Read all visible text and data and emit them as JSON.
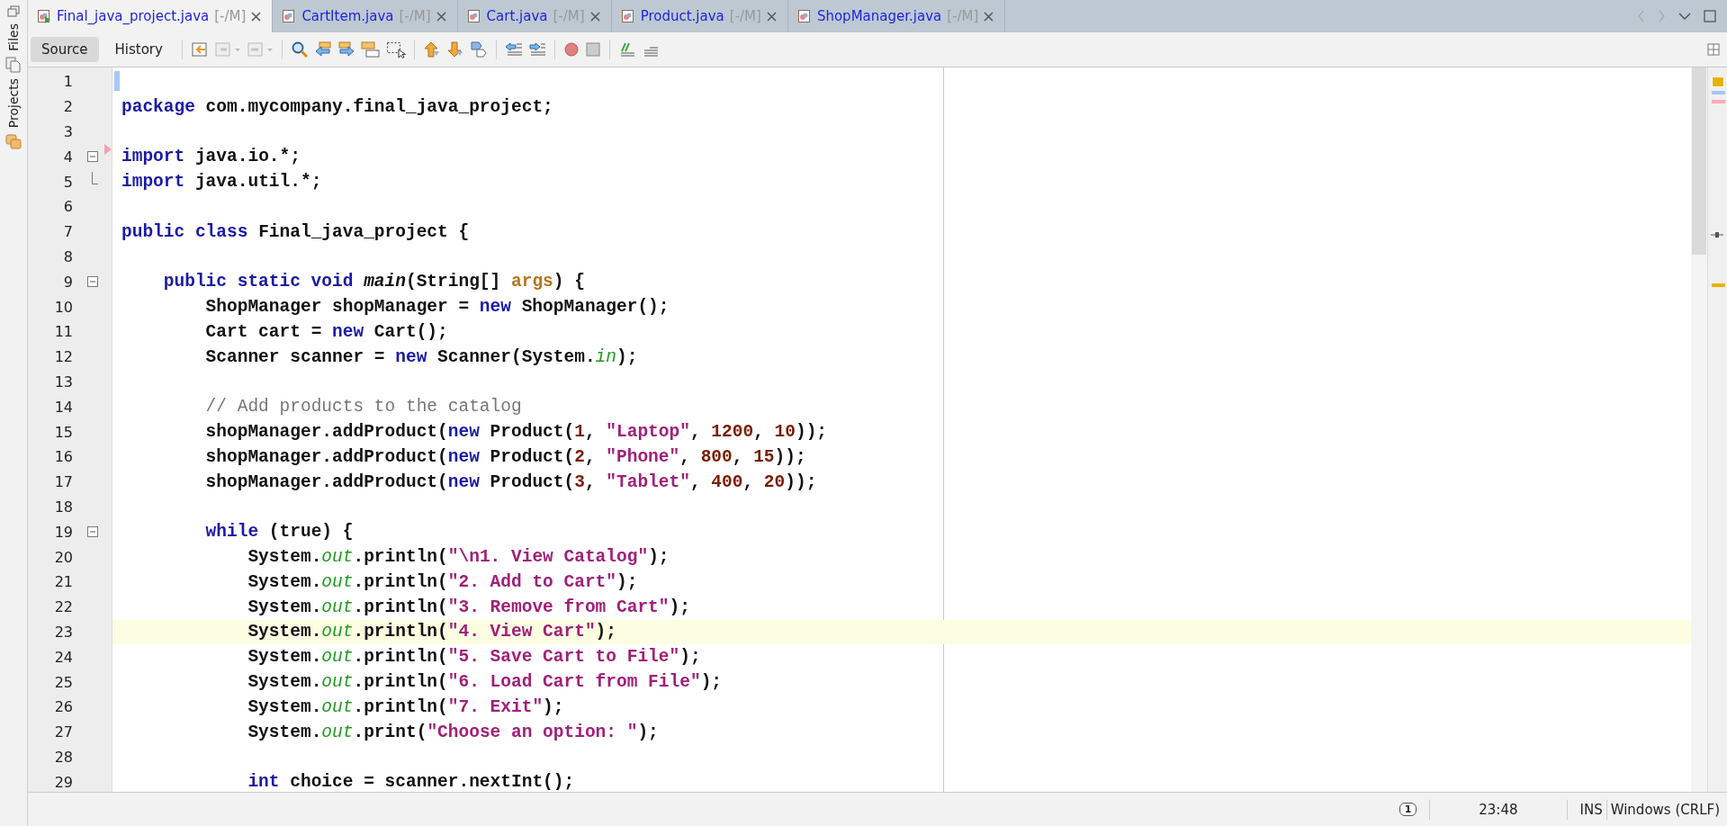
{
  "side_panel": {
    "tabs": [
      {
        "label": "Files"
      },
      {
        "label": "Projects"
      }
    ]
  },
  "tabs": [
    {
      "label": "Final_java_project.java",
      "status": "[-/M]",
      "selected": true,
      "runnable": true
    },
    {
      "label": "CartItem.java",
      "status": "[-/M]",
      "selected": false,
      "runnable": false
    },
    {
      "label": "Cart.java",
      "status": "[-/M]",
      "selected": false,
      "runnable": false
    },
    {
      "label": "Product.java",
      "status": "[-/M]",
      "selected": false,
      "runnable": false
    },
    {
      "label": "ShopManager.java",
      "status": "[-/M]",
      "selected": false,
      "runnable": false
    }
  ],
  "view_buttons": [
    {
      "label": "Source",
      "selected": true
    },
    {
      "label": "History",
      "selected": false
    }
  ],
  "editor": {
    "lines": [
      {
        "number": "1",
        "current": false,
        "caret": true
      },
      {
        "number": "2",
        "tokens": [
          {
            "kind": "kw",
            "text": "package"
          },
          {
            "kind": "plain",
            "text": " com.mycompany.final_java_project;"
          }
        ],
        "current": false
      },
      {
        "number": "3",
        "current": false
      },
      {
        "number": "4",
        "tokens": [
          {
            "kind": "kw",
            "text": "import"
          },
          {
            "kind": "plain",
            "text": " java.io.*;"
          }
        ],
        "current": false,
        "fold_start": true,
        "marker": true
      },
      {
        "number": "5",
        "tokens": [
          {
            "kind": "kw",
            "text": "import"
          },
          {
            "kind": "plain",
            "text": " java.util.*;"
          }
        ],
        "current": false,
        "fold_end": true
      },
      {
        "number": "6",
        "current": false
      },
      {
        "number": "7",
        "tokens": [
          {
            "kind": "kw",
            "text": "public class"
          },
          {
            "kind": "plain",
            "text": " Final_java_project {"
          }
        ],
        "current": false
      },
      {
        "number": "8",
        "current": false
      },
      {
        "number": "9",
        "tokens": [
          {
            "kind": "kw",
            "text": "    public static void "
          },
          {
            "kind": "method",
            "text": "main"
          },
          {
            "kind": "plain",
            "text": "(String[] "
          },
          {
            "kind": "param",
            "text": "args"
          },
          {
            "kind": "plain",
            "text": ") {"
          }
        ],
        "current": false,
        "fold_start": true
      },
      {
        "number": "10",
        "tokens": [
          {
            "kind": "plain",
            "text": "        ShopManager shopManager = "
          },
          {
            "kind": "kw",
            "text": "new"
          },
          {
            "kind": "plain",
            "text": " ShopManager();"
          }
        ],
        "current": false
      },
      {
        "number": "11",
        "tokens": [
          {
            "kind": "plain",
            "text": "        Cart cart = "
          },
          {
            "kind": "kw",
            "text": "new"
          },
          {
            "kind": "plain",
            "text": " Cart();"
          }
        ],
        "current": false
      },
      {
        "number": "12",
        "tokens": [
          {
            "kind": "plain",
            "text": "        Scanner scanner = "
          },
          {
            "kind": "kw",
            "text": "new"
          },
          {
            "kind": "plain",
            "text": " Scanner(System."
          },
          {
            "kind": "field",
            "text": "in"
          },
          {
            "kind": "plain",
            "text": ");"
          }
        ],
        "current": false
      },
      {
        "number": "13",
        "current": false
      },
      {
        "number": "14",
        "tokens": [
          {
            "kind": "comment",
            "text": "        // Add products to the catalog"
          }
        ],
        "current": false
      },
      {
        "number": "15",
        "tokens": [
          {
            "kind": "plain",
            "text": "        shopManager.addProduct("
          },
          {
            "kind": "kw",
            "text": "new"
          },
          {
            "kind": "plain",
            "text": " Product("
          },
          {
            "kind": "num",
            "text": "1"
          },
          {
            "kind": "plain",
            "text": ", "
          },
          {
            "kind": "str",
            "text": "\"Laptop\""
          },
          {
            "kind": "plain",
            "text": ", "
          },
          {
            "kind": "num",
            "text": "1200"
          },
          {
            "kind": "plain",
            "text": ", "
          },
          {
            "kind": "num",
            "text": "10"
          },
          {
            "kind": "plain",
            "text": "));"
          }
        ],
        "current": false
      },
      {
        "number": "16",
        "tokens": [
          {
            "kind": "plain",
            "text": "        shopManager.addProduct("
          },
          {
            "kind": "kw",
            "text": "new"
          },
          {
            "kind": "plain",
            "text": " Product("
          },
          {
            "kind": "num",
            "text": "2"
          },
          {
            "kind": "plain",
            "text": ", "
          },
          {
            "kind": "str",
            "text": "\"Phone\""
          },
          {
            "kind": "plain",
            "text": ", "
          },
          {
            "kind": "num",
            "text": "800"
          },
          {
            "kind": "plain",
            "text": ", "
          },
          {
            "kind": "num",
            "text": "15"
          },
          {
            "kind": "plain",
            "text": "));"
          }
        ],
        "current": false
      },
      {
        "number": "17",
        "tokens": [
          {
            "kind": "plain",
            "text": "        shopManager.addProduct("
          },
          {
            "kind": "kw",
            "text": "new"
          },
          {
            "kind": "plain",
            "text": " Product("
          },
          {
            "kind": "num",
            "text": "3"
          },
          {
            "kind": "plain",
            "text": ", "
          },
          {
            "kind": "str",
            "text": "\"Tablet\""
          },
          {
            "kind": "plain",
            "text": ", "
          },
          {
            "kind": "num",
            "text": "400"
          },
          {
            "kind": "plain",
            "text": ", "
          },
          {
            "kind": "num",
            "text": "20"
          },
          {
            "kind": "plain",
            "text": "));"
          }
        ],
        "current": false
      },
      {
        "number": "18",
        "current": false
      },
      {
        "number": "19",
        "tokens": [
          {
            "kind": "kw",
            "text": "        while"
          },
          {
            "kind": "plain",
            "text": " (true) {"
          }
        ],
        "current": false,
        "fold_start": true
      },
      {
        "number": "20",
        "tokens": [
          {
            "kind": "plain",
            "text": "            System."
          },
          {
            "kind": "field",
            "text": "out"
          },
          {
            "kind": "plain",
            "text": ".println("
          },
          {
            "kind": "str",
            "text": "\"\\n1. View Catalog\""
          },
          {
            "kind": "plain",
            "text": ");"
          }
        ],
        "current": false
      },
      {
        "number": "21",
        "tokens": [
          {
            "kind": "plain",
            "text": "            System."
          },
          {
            "kind": "field",
            "text": "out"
          },
          {
            "kind": "plain",
            "text": ".println("
          },
          {
            "kind": "str",
            "text": "\"2. Add to Cart\""
          },
          {
            "kind": "plain",
            "text": ");"
          }
        ],
        "current": false
      },
      {
        "number": "22",
        "tokens": [
          {
            "kind": "plain",
            "text": "            System."
          },
          {
            "kind": "field",
            "text": "out"
          },
          {
            "kind": "plain",
            "text": ".println("
          },
          {
            "kind": "str",
            "text": "\"3. Remove from Cart\""
          },
          {
            "kind": "plain",
            "text": ");"
          }
        ],
        "current": false
      },
      {
        "number": "23",
        "tokens": [
          {
            "kind": "plain",
            "text": "            System."
          },
          {
            "kind": "field",
            "text": "out"
          },
          {
            "kind": "plain",
            "text": ".println("
          },
          {
            "kind": "str",
            "text": "\"4. View Cart\""
          },
          {
            "kind": "plain",
            "text": ");"
          }
        ],
        "current": true
      },
      {
        "number": "24",
        "tokens": [
          {
            "kind": "plain",
            "text": "            System."
          },
          {
            "kind": "field",
            "text": "out"
          },
          {
            "kind": "plain",
            "text": ".println("
          },
          {
            "kind": "str",
            "text": "\"5. Save Cart to File\""
          },
          {
            "kind": "plain",
            "text": ");"
          }
        ],
        "current": false
      },
      {
        "number": "25",
        "tokens": [
          {
            "kind": "plain",
            "text": "            System."
          },
          {
            "kind": "field",
            "text": "out"
          },
          {
            "kind": "plain",
            "text": ".println("
          },
          {
            "kind": "str",
            "text": "\"6. Load Cart from File\""
          },
          {
            "kind": "plain",
            "text": ");"
          }
        ],
        "current": false
      },
      {
        "number": "26",
        "tokens": [
          {
            "kind": "plain",
            "text": "            System."
          },
          {
            "kind": "field",
            "text": "out"
          },
          {
            "kind": "plain",
            "text": ".println("
          },
          {
            "kind": "str",
            "text": "\"7. Exit\""
          },
          {
            "kind": "plain",
            "text": ");"
          }
        ],
        "current": false
      },
      {
        "number": "27",
        "tokens": [
          {
            "kind": "plain",
            "text": "            System."
          },
          {
            "kind": "field",
            "text": "out"
          },
          {
            "kind": "plain",
            "text": ".print("
          },
          {
            "kind": "str",
            "text": "\"Choose an option: \""
          },
          {
            "kind": "plain",
            "text": ");"
          }
        ],
        "current": false
      },
      {
        "number": "28",
        "current": false
      },
      {
        "number": "29",
        "tokens": [
          {
            "kind": "kw",
            "text": "            int"
          },
          {
            "kind": "plain",
            "text": " choice = scanner.nextInt();"
          }
        ],
        "current": false
      }
    ]
  },
  "status_bar": {
    "notifications": "1",
    "position": "23:48",
    "mode": "INS",
    "line_endings": "Windows (CRLF)"
  }
}
